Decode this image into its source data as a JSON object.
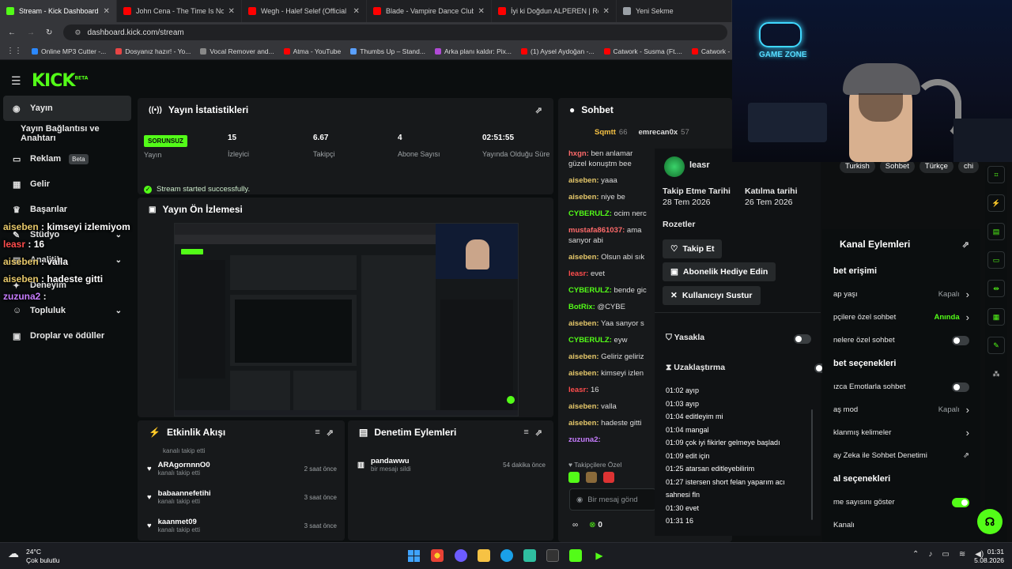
{
  "browser": {
    "tabs": [
      {
        "title": "Stream - Kick Dashboard",
        "color": "#53fc18"
      },
      {
        "title": "John Cena - The Time Is Now (I",
        "color": "#ff0000"
      },
      {
        "title": "Wegh - Halef Selef (Official Mu",
        "color": "#ff0000"
      },
      {
        "title": "Blade - Vampire Dance Club Th",
        "color": "#ff0000"
      },
      {
        "title": "İyi ki Doğdun ALPEREN | Recep",
        "color": "#ff0000"
      },
      {
        "title": "Yeni Sekme",
        "color": "#9aa0a6"
      }
    ],
    "url": "dashboard.kick.com/stream",
    "bookmarks": [
      {
        "label": "Online MP3 Cutter -...",
        "color": "#2b88ff"
      },
      {
        "label": "Dosyanız hazır! - Yo...",
        "color": "#e84545"
      },
      {
        "label": "Vocal Remover and...",
        "color": "#888888"
      },
      {
        "label": "Atma - YouTube",
        "color": "#ff0000"
      },
      {
        "label": "Thumbs Up – Stand...",
        "color": "#5aa0ff"
      },
      {
        "label": "Arka planı kaldır: Pix...",
        "color": "#b04ad6"
      },
      {
        "label": "(1) Aysel Aydoğan -...",
        "color": "#ff0000"
      },
      {
        "label": "Catwork - Susma (Ft....",
        "color": "#ff0000"
      },
      {
        "label": "Catwork - Söyle (Ft....",
        "color": "#ff0000"
      }
    ]
  },
  "app": {
    "logo": "KICK",
    "logo_sup": "BETA",
    "sidebar": [
      {
        "label": "Yayın",
        "icon": "broadcast-icon",
        "glyph": "◉"
      },
      {
        "label": "Yayın Bağlantısı ve Anahtarı",
        "icon": "",
        "glyph": ""
      },
      {
        "label": "Reklam",
        "icon": "ad-icon",
        "glyph": "▭",
        "badge": "Beta"
      },
      {
        "label": "Gelir",
        "icon": "revenue-icon",
        "glyph": "▦"
      },
      {
        "label": "Başarılar",
        "icon": "trophy-icon",
        "glyph": "♛"
      },
      {
        "label": "Stüdyo",
        "icon": "studio-icon",
        "glyph": "✎",
        "chevron": true
      },
      {
        "label": "Analitik",
        "icon": "analytics-icon",
        "glyph": "▤",
        "chevron": true
      },
      {
        "label": "Deneyim",
        "icon": "experience-icon",
        "glyph": "✦"
      },
      {
        "label": "Topluluk",
        "icon": "community-icon",
        "glyph": "☺",
        "chevron": true
      },
      {
        "label": "Droplar ve ödüller",
        "icon": "gift-icon",
        "glyph": "▣"
      }
    ],
    "stats_panel": {
      "title": "Yayın İstatistikleri",
      "status_badge": "SORUNSUZ",
      "stats": [
        {
          "value": "",
          "label": "Yayın"
        },
        {
          "value": "15",
          "label": "İzleyici"
        },
        {
          "value": "6.67",
          "label": "Takipçi"
        },
        {
          "value": "4",
          "label": "Abone Sayısı"
        },
        {
          "value": "02:51:55",
          "label": "Yayında Olduğu Süre"
        }
      ],
      "success_msg": "Stream started successfully."
    },
    "preview_panel": {
      "title": "Yayın Ön İzlemesi"
    },
    "activity_panel": {
      "title": "Etkinlik Akışı",
      "first_sub": "kanalı takip etti",
      "items": [
        {
          "user": "ARAgornnnO0",
          "sub": "kanalı takip etti",
          "time": "2 saat önce"
        },
        {
          "user": "babaannefetihi",
          "sub": "kanalı takip etti",
          "time": "3 saat önce"
        },
        {
          "user": "kaanmet09",
          "sub": "kanalı takip etti",
          "time": "3 saat önce"
        }
      ]
    },
    "moderation_panel": {
      "title": "Denetim Eylemleri",
      "items": [
        {
          "user": "pandawwu",
          "sub": "bir mesajı sildi",
          "time": "54 dakika önce"
        }
      ]
    },
    "chat_panel": {
      "title": "Sohbet",
      "top_users": [
        {
          "name": "Sqmtt",
          "count": "66"
        },
        {
          "name": "emrecan0x",
          "count": "57"
        }
      ],
      "lines": [
        {
          "user": "hxgn:",
          "text": " ben anlamar",
          "color": "#ff6a6a"
        },
        {
          "user": "",
          "text": "güzel konuştm bee",
          "color": "#ddd"
        },
        {
          "user": "aiseben:",
          "text": " yaaa",
          "color": "#e6c86a"
        },
        {
          "user": "aiseben:",
          "text": " niye be",
          "color": "#e6c86a"
        },
        {
          "user": "CYBERULZ:",
          "text": " ocim nerc",
          "color": "#53fc18"
        },
        {
          "user": "mustafa861037:",
          "text": " ama",
          "color": "#ff6a6a"
        },
        {
          "user": "",
          "text": "sanyor abi",
          "color": "#ddd"
        },
        {
          "user": "aiseben:",
          "text": " Olsun abi sık",
          "color": "#e6c86a"
        },
        {
          "user": "leasr:",
          "text": " evet",
          "color": "#ff4d4d"
        },
        {
          "user": "CYBERULZ:",
          "text": " bende gic",
          "color": "#53fc18"
        },
        {
          "user": "BotRix:",
          "text": " @CYBE",
          "color": "#53fc18"
        },
        {
          "user": "aiseben:",
          "text": " Yaa sanyor s",
          "color": "#e6c86a"
        },
        {
          "user": "CYBERULZ:",
          "text": " eyw",
          "color": "#53fc18"
        },
        {
          "user": "aiseben:",
          "text": " Geliriz geliriz",
          "color": "#e6c86a"
        },
        {
          "user": "aiseben:",
          "text": " kimseyi izlen",
          "color": "#e6c86a"
        },
        {
          "user": "leasr:",
          "text": " 16",
          "color": "#ff4d4d"
        },
        {
          "user": "aiseben:",
          "text": " valla",
          "color": "#e6c86a"
        },
        {
          "user": "aiseben:",
          "text": " hadeste gitti",
          "color": "#e6c86a"
        },
        {
          "user": "zuzuna2:",
          "text": "",
          "color": "#c77dff"
        }
      ],
      "followers_only": "Takipçilere Özel",
      "input_placeholder": "Bir mesaj gönd",
      "points": "0"
    },
    "overlay_chat": [
      {
        "user": "aiseben",
        "text": " : kimseyi izlemiyom",
        "color": "#e6c86a"
      },
      {
        "user": "leasr",
        "text": " : 16",
        "color": "#ff4d4d"
      },
      {
        "user": "aiseben",
        "text": " : valla",
        "color": "#e6c86a"
      },
      {
        "user": "aiseben",
        "text": " : hadeste gitti",
        "color": "#e6c86a"
      },
      {
        "user": "zuzuna2",
        "text": " :",
        "color": "#c77dff"
      }
    ],
    "user_card": {
      "username": "leasr",
      "follow_date_label": "Takip Etme Tarihi",
      "follow_date": "28 Tem 2026",
      "join_date_label": "Katılma tarihi",
      "join_date": "26 Tem 2026",
      "badges_label": "Rozetler",
      "follow_btn": "Takip Et",
      "gift_btn": "Abonelik Hediye Edin",
      "mute_btn": "Kullanıcıyı Sustur",
      "ban_label": "Yasakla",
      "timeout_label": "Uzaklaştırma",
      "log": [
        "01:02 ayıp",
        "01:03 ayıp",
        "01:04 editleyim mi",
        "01:04 mangal",
        "01:09 çok iyi fikirler gelmeye başladı",
        "01:09 edit için",
        "01:25 atarsan editleyebilirim",
        "01:27 istersen short felan yaparım acı",
        "sahnesi fln",
        "01:30 evet",
        "01:31 16"
      ]
    },
    "tags": [
      "Turkish",
      "Sohbet",
      "Türkçe",
      "chi"
    ],
    "channel_actions": {
      "title": "Kanal Eylemleri",
      "rows": [
        {
          "type": "head",
          "label": "bet erişimi"
        },
        {
          "type": "row",
          "label": "ap yaşı",
          "value": "Kapalı",
          "arrow": true
        },
        {
          "type": "row",
          "label": "pçilere özel sohbet",
          "value": "Anında",
          "green": true,
          "arrow": true
        },
        {
          "type": "toggle",
          "label": "nelere özel sohbet",
          "on": false
        },
        {
          "type": "head",
          "label": "bet seçenekleri"
        },
        {
          "type": "toggle",
          "label": "ızca Emotlarla sohbet",
          "on": false
        },
        {
          "type": "row",
          "label": "aş mod",
          "value": "Kapalı",
          "arrow": true
        },
        {
          "type": "row",
          "label": "klanmış kelimeler",
          "value": "",
          "arrow": true
        },
        {
          "type": "row",
          "label": "ay Zeka ile Sohbet Denetimi",
          "value": "",
          "ext": true
        },
        {
          "type": "head",
          "label": "al seçenekleri"
        },
        {
          "type": "toggle",
          "label": "me sayısını göster",
          "on": true
        },
        {
          "type": "row",
          "label": "Kanalı",
          "value": ""
        }
      ]
    }
  },
  "webcam": {
    "sign": "GAME ZONE"
  },
  "taskbar": {
    "weather_temp": "24°C",
    "weather_desc": "Çok bulutlu",
    "time": "01:31",
    "date": "5.08.2026"
  }
}
